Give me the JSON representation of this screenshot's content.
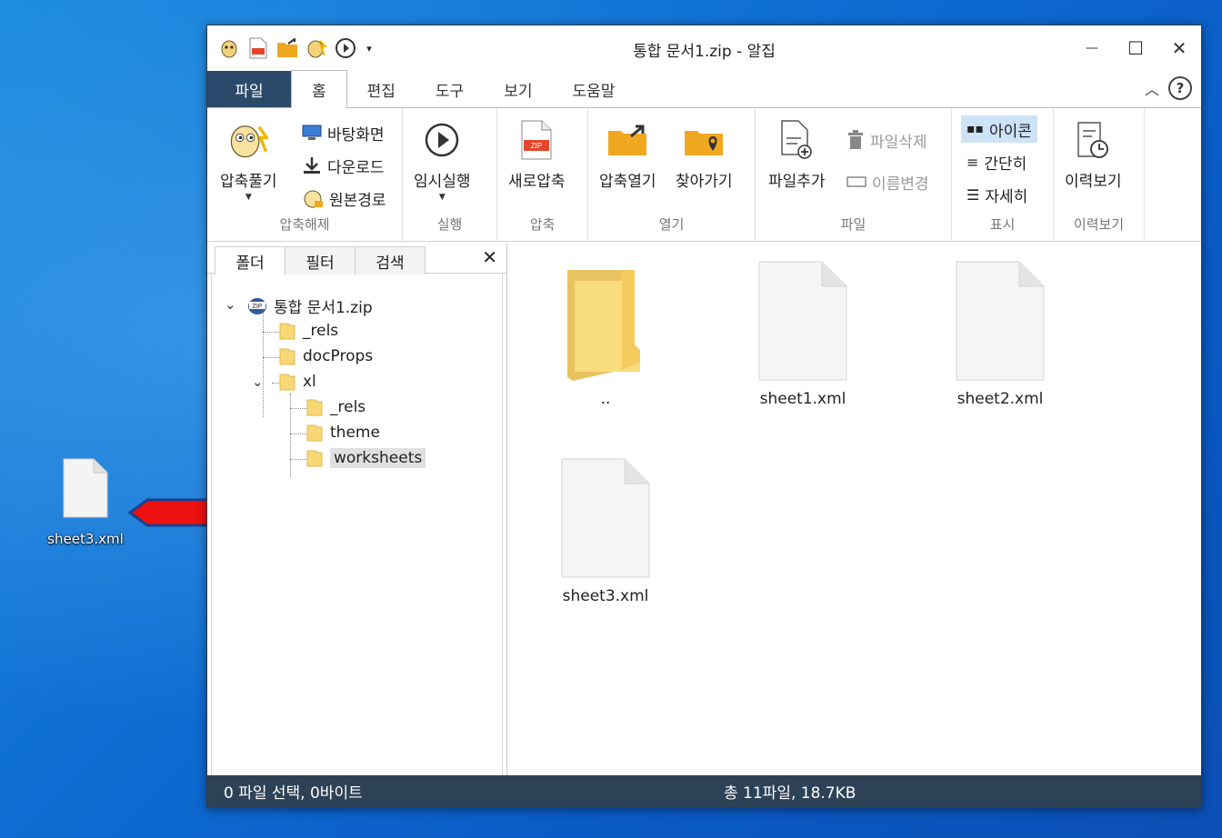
{
  "desktop": {
    "file_label": "sheet3.xml"
  },
  "window": {
    "title": "통합 문서1.zip - 알집",
    "controls": {
      "minimize": "—",
      "maximize": "☐",
      "close": "✕"
    }
  },
  "menu": {
    "tabs": [
      "파일",
      "홈",
      "편집",
      "도구",
      "보기",
      "도움말"
    ],
    "active_tab": "홈"
  },
  "ribbon": {
    "extract": {
      "button": "압축풀기",
      "items": [
        "바탕화면",
        "다운로드",
        "원본경로"
      ],
      "group": "압축해제"
    },
    "run": {
      "button": "임시실행",
      "group": "실행"
    },
    "compress": {
      "button": "새로압축",
      "group": "압축"
    },
    "open": {
      "buttons": [
        "압축열기",
        "찾아가기"
      ],
      "group": "열기"
    },
    "file": {
      "add": "파일추가",
      "delete": "파일삭제",
      "rename": "이름변경",
      "group": "파일"
    },
    "view": {
      "items": [
        "아이콘",
        "간단히",
        "자세히"
      ],
      "group": "표시",
      "selected": "아이콘"
    },
    "history": {
      "button": "이력보기",
      "group": "이력보기"
    }
  },
  "left_panel": {
    "tabs": [
      "폴더",
      "필터",
      "검색"
    ],
    "close": "✕",
    "tree": {
      "root": "통합 문서1.zip",
      "rels": "_rels",
      "docprops": "docProps",
      "xl": "xl",
      "xl_rels": "_rels",
      "theme": "theme",
      "worksheets": "worksheets"
    }
  },
  "files": [
    {
      "name": "..",
      "type": "folder"
    },
    {
      "name": "sheet1.xml",
      "type": "file"
    },
    {
      "name": "sheet2.xml",
      "type": "file"
    },
    {
      "name": "sheet3.xml",
      "type": "file"
    }
  ],
  "status": {
    "left": "0 파일 선택,  0바이트",
    "right": "총 11파일,  18.7KB"
  },
  "colors": {
    "status_bg": "#2e4257",
    "file_tab_bg": "#2b4a6b",
    "arrow_fill": "#ee1111",
    "arrow_outline": "#1b3f8f"
  }
}
